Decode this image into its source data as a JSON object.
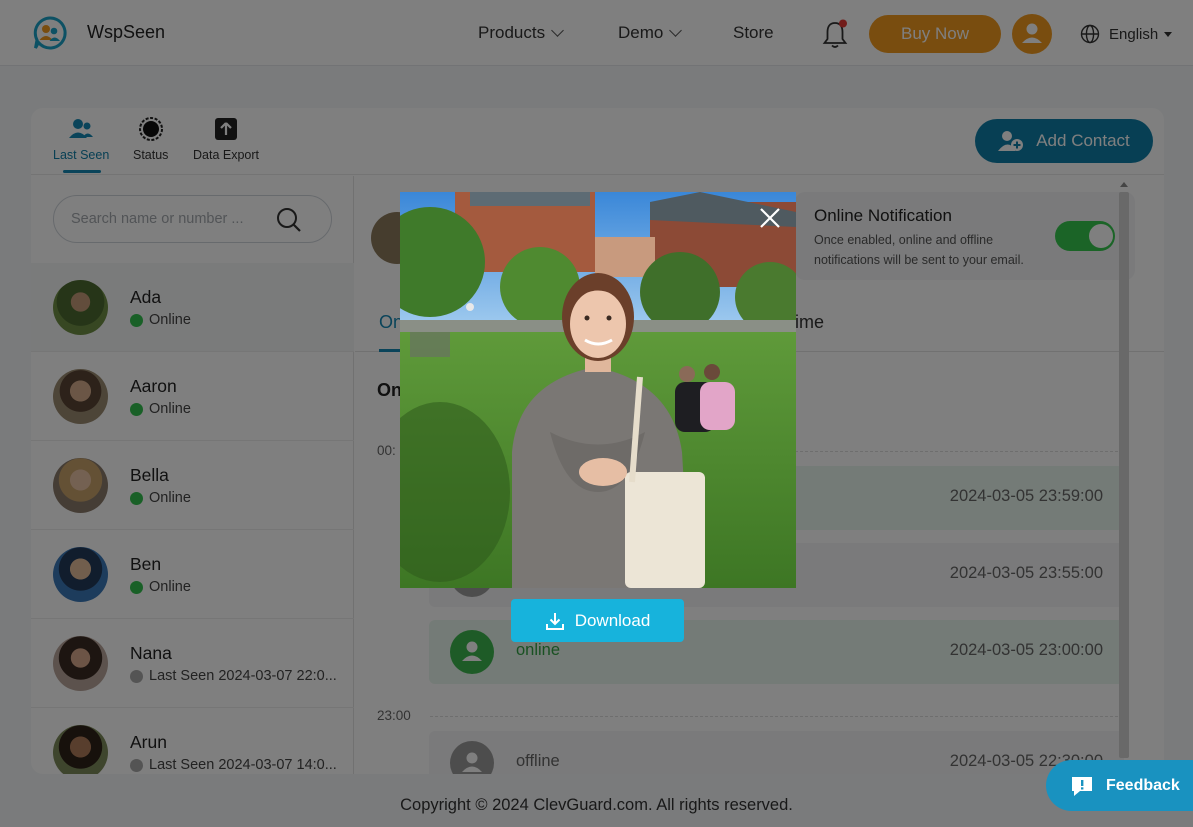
{
  "brand": "WspSeen",
  "nav": {
    "products": "Products",
    "demo": "Demo",
    "store": "Store",
    "buy_now": "Buy Now",
    "language": "English"
  },
  "tabs": [
    {
      "label": "Last Seen",
      "icon": "users-icon",
      "active": true
    },
    {
      "label": "Status",
      "icon": "status-ring-icon"
    },
    {
      "label": "Data Export",
      "icon": "upload-icon"
    }
  ],
  "add_contact": "Add Contact",
  "search": {
    "placeholder": "Search name or number ..."
  },
  "contacts": [
    {
      "name": "Ada",
      "status": "Online",
      "online": true
    },
    {
      "name": "Aaron",
      "status": "Online",
      "online": true
    },
    {
      "name": "Bella",
      "status": "Online",
      "online": true
    },
    {
      "name": "Ben",
      "status": "Online",
      "online": true
    },
    {
      "name": "Nana",
      "status": "Last Seen 2024-03-07 22:0...",
      "online": false
    },
    {
      "name": "Arun",
      "status": "Last Seen 2024-03-07 14:0...",
      "online": false
    }
  ],
  "notification": {
    "title": "Online Notification",
    "description": "Once enabled, online and offline notifications will be sent to your email.",
    "enabled": true
  },
  "subtabs": {
    "first": "On",
    "second": "ime"
  },
  "section_title": "On",
  "timeline": {
    "label_1": "00:",
    "label_2": "23:00",
    "rows": [
      {
        "label": "",
        "time": "2024-03-05 23:59:00",
        "type": "online"
      },
      {
        "label": "",
        "time": "2024-03-05 23:55:00",
        "type": "offline"
      },
      {
        "label": "online",
        "time": "2024-03-05 23:00:00",
        "type": "online"
      },
      {
        "label": "offline",
        "time": "2024-03-05 22:30:00",
        "type": "offline"
      }
    ]
  },
  "footer": "Copyright © 2024 ClevGuard.com. All rights reserved.",
  "modal": {
    "download": "Download"
  },
  "feedback": "Feedback",
  "colors": {
    "primary": "#0f7fa8",
    "accent": "#f29a1f",
    "online": "#33c14e",
    "download": "#17b3dc"
  }
}
